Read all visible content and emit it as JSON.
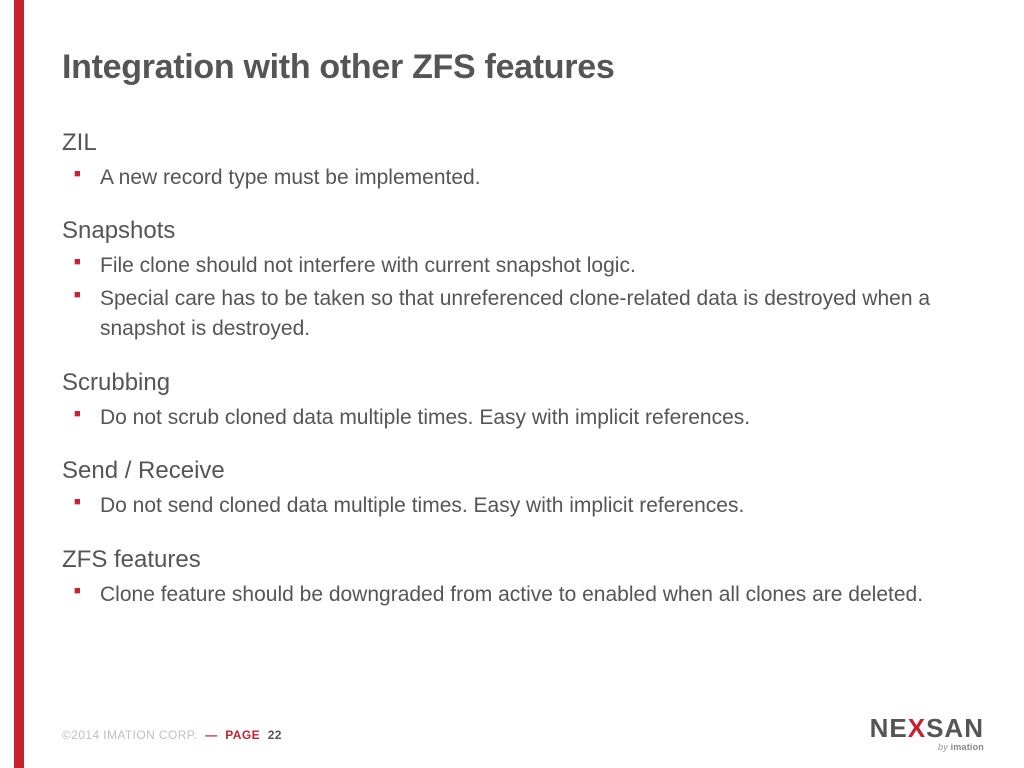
{
  "slide": {
    "title": "Integration with other ZFS features",
    "sections": [
      {
        "heading": "ZIL",
        "items": [
          "A new record type must be implemented."
        ]
      },
      {
        "heading": "Snapshots",
        "items": [
          "File clone should not interfere with current snapshot logic.",
          "Special care has to be taken so that unreferenced clone-related data is destroyed when a snapshot is destroyed."
        ]
      },
      {
        "heading": "Scrubbing",
        "items": [
          "Do not scrub cloned data multiple times. Easy with implicit references."
        ]
      },
      {
        "heading": "Send / Receive",
        "items": [
          "Do not send cloned data multiple times. Easy with implicit references."
        ]
      },
      {
        "heading": "ZFS features",
        "items": [
          "Clone feature should be downgraded from active to enabled when all clones are deleted."
        ]
      }
    ]
  },
  "footer": {
    "copyright": "©2014 IMATION CORP.",
    "dash": "—",
    "page_label": "PAGE",
    "page_number": "22"
  },
  "logo": {
    "part1": "NE",
    "part2": "X",
    "part3": "SAN",
    "sub_by": "by ",
    "sub_brand": "imation"
  }
}
